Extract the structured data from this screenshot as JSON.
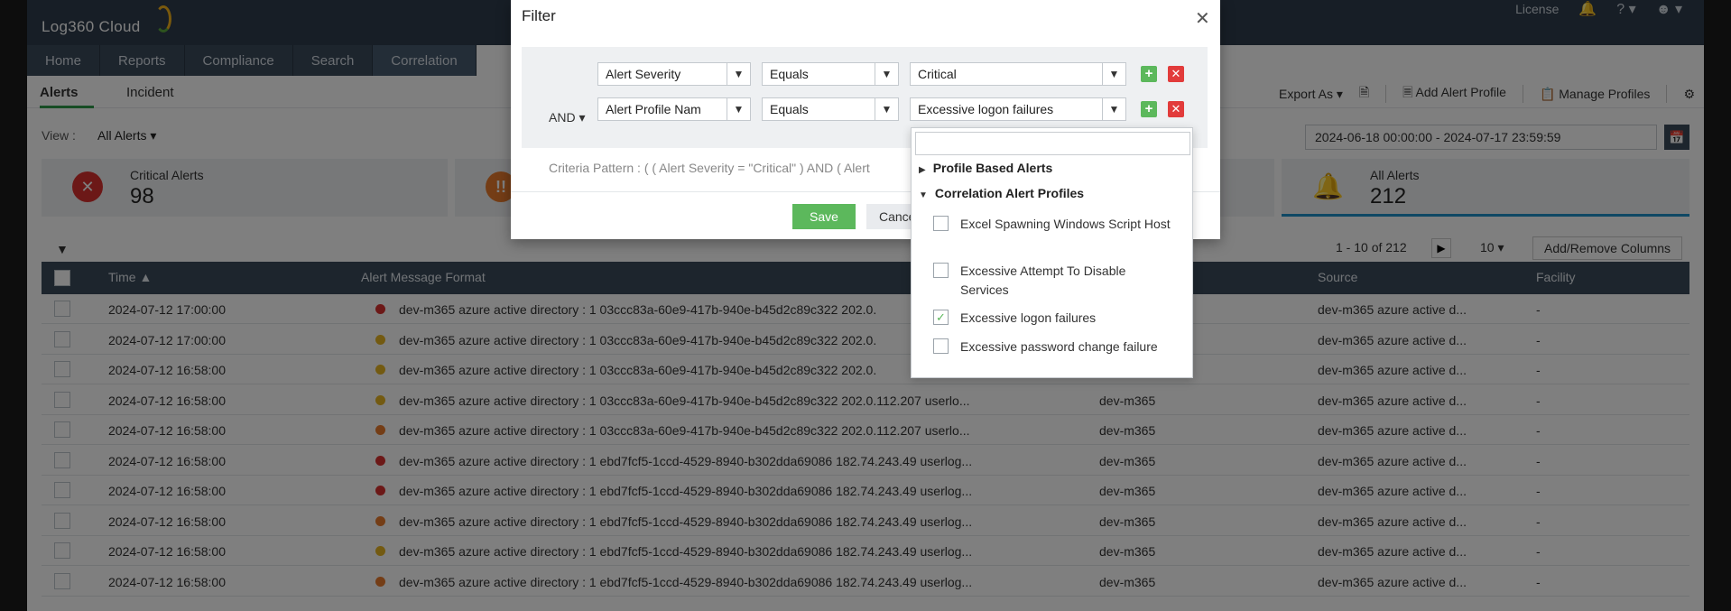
{
  "header": {
    "logo_text": "Log360 Cloud",
    "license_label": "License",
    "help_label": "?"
  },
  "nav": [
    "Home",
    "Reports",
    "Compliance",
    "Search",
    "Correlation"
  ],
  "subtabs": [
    "Alerts",
    "Incident"
  ],
  "actions": {
    "export_label": "Export As",
    "add_profile_label": "Add Alert Profile",
    "manage_profiles_label": "Manage Profiles"
  },
  "view": {
    "label": "View :",
    "selected": "All Alerts"
  },
  "date_range": "2024-06-18 00:00:00 - 2024-07-17 23:59:59",
  "cards": [
    {
      "label": "Critical Alerts",
      "value": "98",
      "icon": "x-icon",
      "color": "#d9312f"
    },
    {
      "label": "",
      "value": "",
      "icon": "exclamation-icon",
      "color": "#e87b2c"
    },
    {
      "label": "All Alerts",
      "value": "212",
      "icon": "bell-icon",
      "color": "#1e90c8"
    }
  ],
  "pagination": {
    "range": "1 - 10 of 212",
    "per_page": "10",
    "add_remove_columns": "Add/Remove Columns"
  },
  "table": {
    "headers": {
      "time": "Time",
      "message": "Alert Message Format",
      "source": "Source",
      "facility": "Facility"
    },
    "rows": [
      {
        "time": "2024-07-12 17:00:00",
        "severity_color": "#d9312f",
        "message": "dev-m365 azure active directory : 1 03ccc83a-60e9-417b-940e-b45d2c89c322 202.0.",
        "device": "",
        "source": "dev-m365 azure active d...",
        "facility": "-"
      },
      {
        "time": "2024-07-12 17:00:00",
        "severity_color": "#e6b422",
        "message": "dev-m365 azure active directory : 1 03ccc83a-60e9-417b-940e-b45d2c89c322 202.0.",
        "device": "",
        "source": "dev-m365 azure active d...",
        "facility": "-"
      },
      {
        "time": "2024-07-12 16:58:00",
        "severity_color": "#e6b422",
        "message": "dev-m365 azure active directory : 1 03ccc83a-60e9-417b-940e-b45d2c89c322 202.0.",
        "device": "",
        "source": "dev-m365 azure active d...",
        "facility": "-"
      },
      {
        "time": "2024-07-12 16:58:00",
        "severity_color": "#e6b422",
        "message": "dev-m365 azure active directory : 1 03ccc83a-60e9-417b-940e-b45d2c89c322 202.0.112.207 userlo...",
        "device": "dev-m365",
        "source": "dev-m365 azure active d...",
        "facility": "-"
      },
      {
        "time": "2024-07-12 16:58:00",
        "severity_color": "#e87b2c",
        "message": "dev-m365 azure active directory : 1 03ccc83a-60e9-417b-940e-b45d2c89c322 202.0.112.207 userlo...",
        "device": "dev-m365",
        "source": "dev-m365 azure active d...",
        "facility": "-"
      },
      {
        "time": "2024-07-12 16:58:00",
        "severity_color": "#d9312f",
        "message": "dev-m365 azure active directory : 1 ebd7fcf5-1ccd-4529-8940-b302dda69086 182.74.243.49 userlog...",
        "device": "dev-m365",
        "source": "dev-m365 azure active d...",
        "facility": "-"
      },
      {
        "time": "2024-07-12 16:58:00",
        "severity_color": "#d9312f",
        "message": "dev-m365 azure active directory : 1 ebd7fcf5-1ccd-4529-8940-b302dda69086 182.74.243.49 userlog...",
        "device": "dev-m365",
        "source": "dev-m365 azure active d...",
        "facility": "-"
      },
      {
        "time": "2024-07-12 16:58:00",
        "severity_color": "#e87b2c",
        "message": "dev-m365 azure active directory : 1 ebd7fcf5-1ccd-4529-8940-b302dda69086 182.74.243.49 userlog...",
        "device": "dev-m365",
        "source": "dev-m365 azure active d...",
        "facility": "-"
      },
      {
        "time": "2024-07-12 16:58:00",
        "severity_color": "#e6b422",
        "message": "dev-m365 azure active directory : 1 ebd7fcf5-1ccd-4529-8940-b302dda69086 182.74.243.49 userlog...",
        "device": "dev-m365",
        "source": "dev-m365 azure active d...",
        "facility": "-"
      },
      {
        "time": "2024-07-12 16:58:00",
        "severity_color": "#e87b2c",
        "message": "dev-m365 azure active directory : 1 ebd7fcf5-1ccd-4529-8940-b302dda69086 182.74.243.49 userlog...",
        "device": "dev-m365",
        "source": "dev-m365 azure active d...",
        "facility": "-"
      }
    ]
  },
  "modal": {
    "title": "Filter",
    "logic_operator": "AND",
    "criteria": [
      {
        "field": "Alert Severity",
        "operator": "Equals",
        "value": "Critical"
      },
      {
        "field": "Alert Profile Nam",
        "operator": "Equals",
        "value": "Excessive logon failures"
      }
    ],
    "criteria_pattern": "Criteria Pattern : ( ( Alert Severity = \"Critical\" ) AND ( Alert",
    "save_label": "Save",
    "cancel_label": "Cancel"
  },
  "dropdown": {
    "search_placeholder": "",
    "groups": [
      {
        "label": "Profile Based Alerts",
        "expanded": false
      },
      {
        "label": "Correlation Alert Profiles",
        "expanded": true
      }
    ],
    "items": [
      {
        "label": "Excel Spawning Windows Script Host",
        "checked": false
      },
      {
        "label": "Excessive Attempt To Disable Services",
        "checked": false
      },
      {
        "label": "Excessive logon failures",
        "checked": true
      },
      {
        "label": "Excessive password change failure",
        "checked": false
      }
    ]
  }
}
